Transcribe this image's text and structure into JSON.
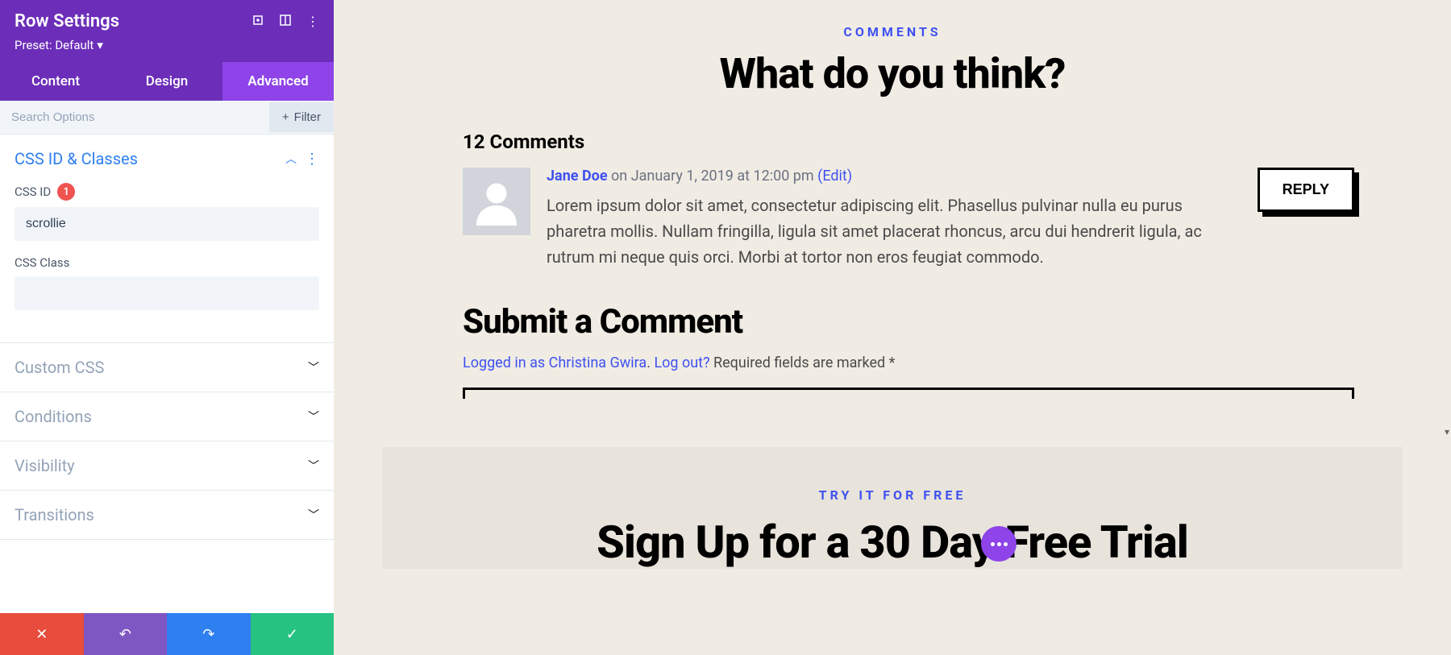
{
  "sidebar": {
    "title": "Row Settings",
    "preset_label": "Preset: Default",
    "tabs": [
      "Content",
      "Design",
      "Advanced"
    ],
    "active_tab": 2,
    "search_placeholder": "Search Options",
    "filter_label": "Filter",
    "sections": {
      "css_id_classes": {
        "title": "CSS ID & Classes",
        "open": true,
        "fields": {
          "css_id": {
            "label": "CSS ID",
            "badge": "1",
            "value": "scrollie"
          },
          "css_class": {
            "label": "CSS Class",
            "value": ""
          }
        }
      },
      "custom_css": {
        "title": "Custom CSS",
        "open": false
      },
      "conditions": {
        "title": "Conditions",
        "open": false
      },
      "visibility": {
        "title": "Visibility",
        "open": false
      },
      "transitions": {
        "title": "Transitions",
        "open": false
      }
    }
  },
  "preview": {
    "comments_label": "COMMENTS",
    "comments_heading": "What do you think?",
    "comments_count": "12 Comments",
    "comment": {
      "author": "Jane Doe",
      "meta": "on January 1, 2019 at 12:00 pm",
      "edit": "(Edit)",
      "text": "Lorem ipsum dolor sit amet, consectetur adipiscing elit. Phasellus pulvinar nulla eu purus pharetra mollis. Nullam fringilla, ligula sit amet placerat rhoncus, arcu dui hendrerit ligula, ac rutrum mi neque quis orci. Morbi at tortor non eros feugiat commodo.",
      "reply": "REPLY"
    },
    "submit_heading": "Submit a Comment",
    "submit_logged_in": "Logged in as Christina Gwira",
    "submit_logout": "Log out?",
    "submit_required": " Required fields are marked *",
    "trial_label": "TRY IT FOR FREE",
    "trial_heading": "Sign Up for a 30 Day Free Trial"
  }
}
